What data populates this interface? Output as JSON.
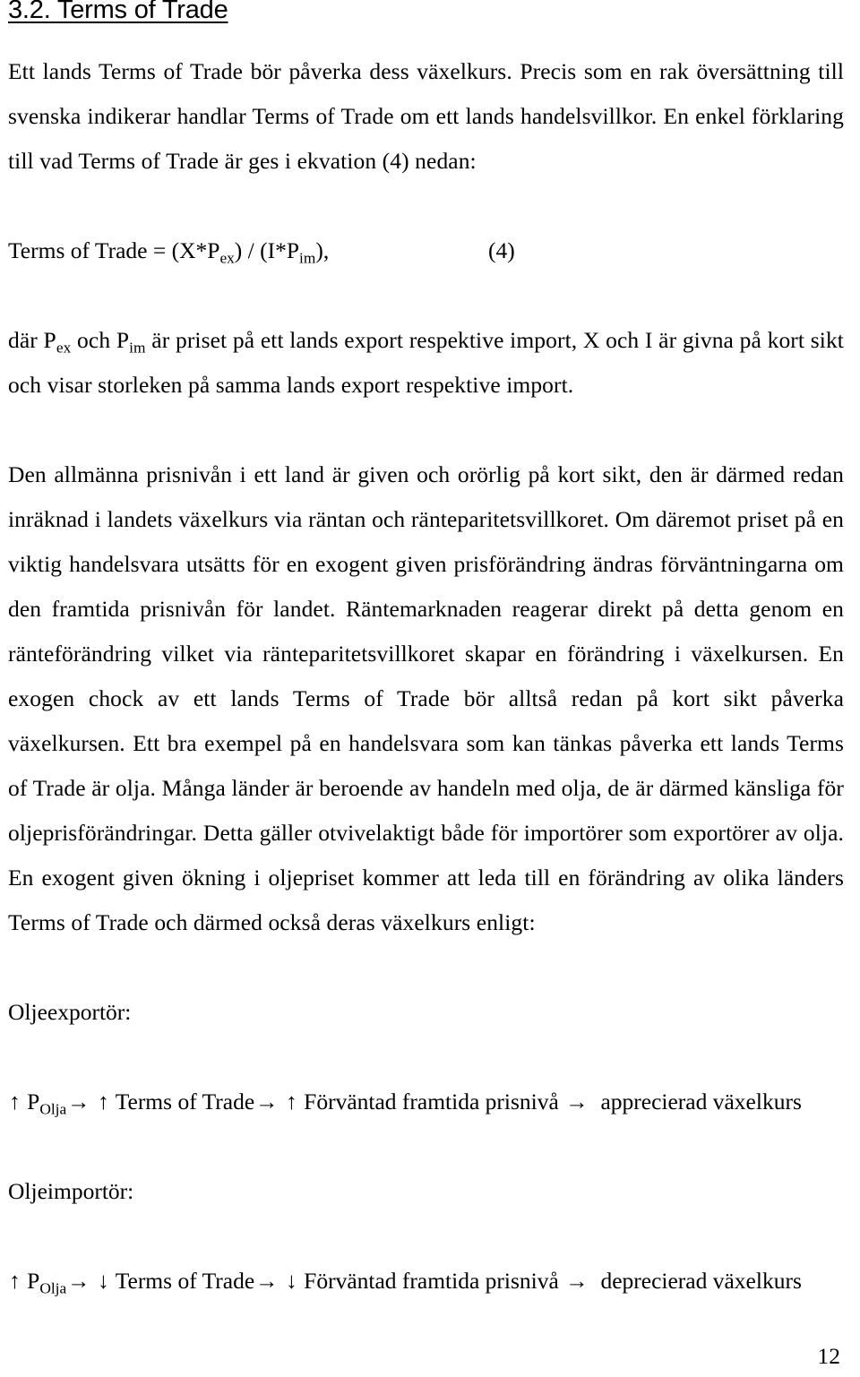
{
  "document": {
    "heading": "3.2. Terms of Trade",
    "page_number": "12",
    "paragraph_1": "Ett lands Terms of Trade bör påverka dess växelkurs. Precis som en rak översättning till svenska indikerar handlar Terms of Trade om ett lands handelsvillkor. En enkel förklaring till vad Terms of Trade är ges i ekvation (4) nedan:",
    "equation": {
      "lhs": "Terms of Trade = (X*P",
      "sub_1": "ex",
      "mid": ") / (I*P",
      "sub_2": "im",
      "rhs": "),",
      "number": "(4)"
    },
    "paragraph_2": {
      "part_a": "där P",
      "sub_1": "ex",
      "part_b": " och P",
      "sub_2": "im",
      "part_c": " är priset på ett lands export respektive import, X och I är givna på kort sikt och visar storleken på samma lands export respektive import."
    },
    "paragraph_3": "Den allmänna prisnivån i ett land är given och orörlig på kort sikt, den är därmed redan inräknad i landets växelkurs via räntan och ränteparitetsvillkoret. Om däremot priset på en viktig handelsvara utsätts för en exogent given prisförändring ändras förväntningarna om den framtida prisnivån för landet. Räntemarknaden reagerar direkt på detta genom en ränteförändring vilket via ränteparitetsvillkoret skapar en förändring i växelkursen. En exogen chock av ett lands Terms of Trade bör alltså redan på kort sikt påverka växelkursen. Ett bra exempel på en handelsvara som kan tänkas påverka ett lands Terms of Trade är olja. Många länder är beroende av handeln med olja, de är därmed känsliga för oljeprisförändringar. Detta gäller otvivelaktigt både för importörer som exportörer av olja. En exogent given ökning i oljepriset kommer att leda till en förändring av olika länders Terms of Trade och därmed också deras växelkurs enligt:",
    "exporter_label": "Oljeexportör:",
    "exporter_chain": {
      "arrow_price": "↑",
      "price_symbol": "P",
      "price_sub": "Olja",
      "arrow_1": "→",
      "arrow_tot": "↑",
      "tot_label": "Terms of Trade",
      "arrow_2": "→",
      "arrow_price_level": "↑",
      "price_level_label": "Förväntad framtida prisnivå",
      "arrow_3": "→",
      "result": "apprecierad växelkurs"
    },
    "importer_label": "Oljeimportör:",
    "importer_chain": {
      "arrow_price": "↑",
      "price_symbol": "P",
      "price_sub": "Olja",
      "arrow_1": "→",
      "arrow_tot": "↓",
      "tot_label": "Terms of Trade",
      "arrow_2": "→",
      "arrow_price_level": "↓",
      "price_level_label": "Förväntad framtida prisnivå",
      "arrow_3": "→",
      "result": "deprecierad växelkurs"
    }
  }
}
